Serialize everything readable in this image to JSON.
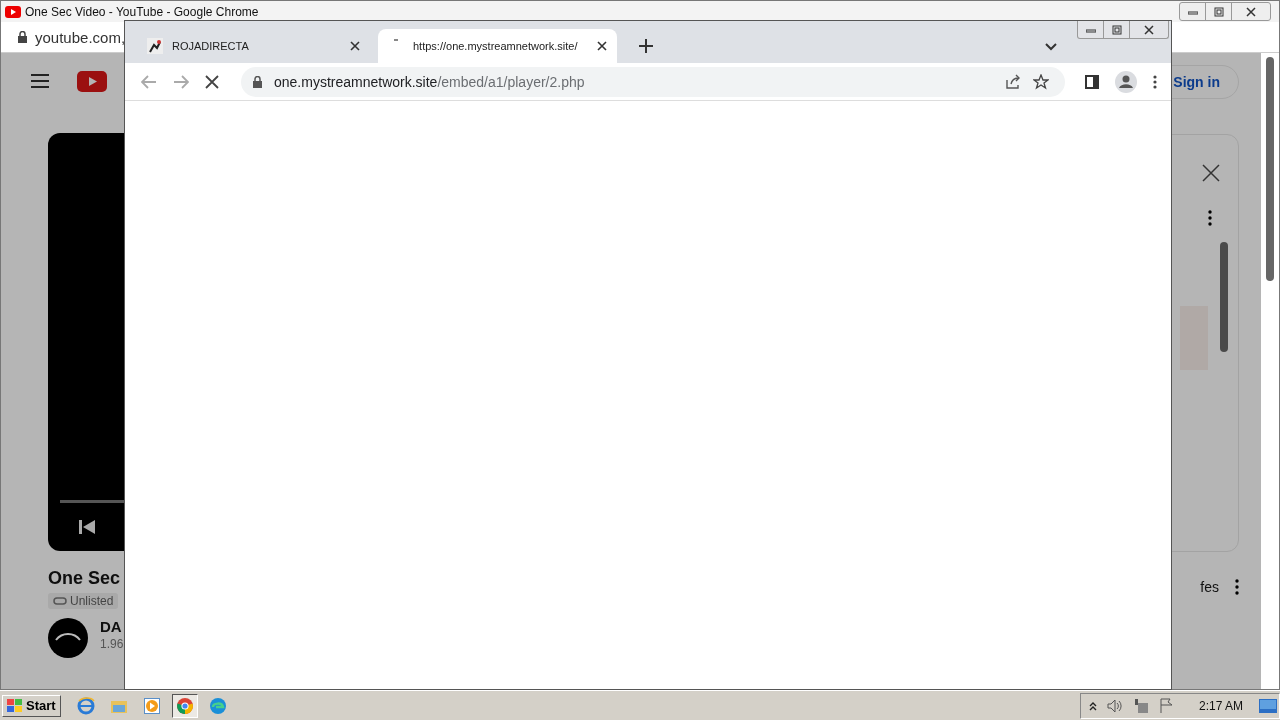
{
  "background_window": {
    "title": "One Sec Video - YouTube - Google Chrome",
    "address": "youtube.com,",
    "page": {
      "sign_in": "Sign in",
      "video_title": "One Sec",
      "visibility": "Unlisted",
      "channel": "DA",
      "subscribers": "1.96",
      "side_item_text": "fes"
    }
  },
  "popup_window": {
    "tabs": [
      {
        "title": "ROJADIRECTA",
        "selected": false
      },
      {
        "title": "https://one.mystreamnetwork.site/",
        "selected": true
      }
    ],
    "address": {
      "host": "one.mystreamnetwork.site",
      "path": "/embed/a1/player/2.php"
    },
    "loading": true
  },
  "taskbar": {
    "start": "Start",
    "apps": [
      {
        "kind": "ie",
        "selected": false
      },
      {
        "kind": "explorer",
        "selected": false
      },
      {
        "kind": "media",
        "selected": false
      },
      {
        "kind": "chrome",
        "selected": true
      },
      {
        "kind": "edge",
        "selected": false
      }
    ],
    "clock": "2:17 AM"
  }
}
